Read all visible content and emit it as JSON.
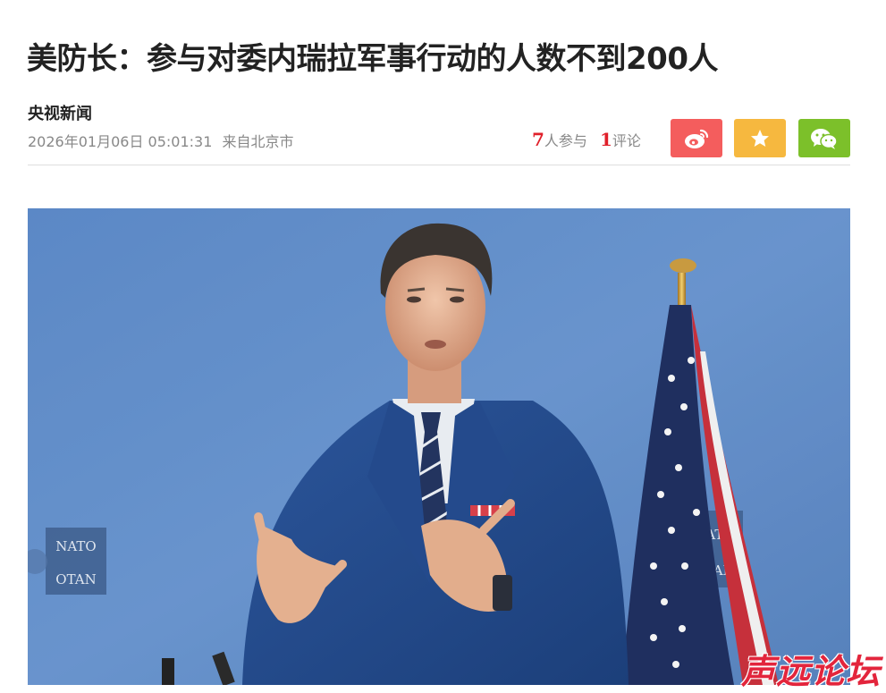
{
  "article": {
    "title": "美防长：参与对委内瑞拉军事行动的人数不到200人",
    "source": "央视新闻",
    "timestamp": "2026年01月06日 05:01:31",
    "location": "来自北京市"
  },
  "stats": {
    "participants_count": "7",
    "participants_label": "人参与",
    "comments_count": "1",
    "comments_label": "评论"
  },
  "share": [
    {
      "name": "weibo-icon",
      "color": "#f45d5d"
    },
    {
      "name": "star-icon",
      "color": "#f6b83f"
    },
    {
      "name": "wechat-icon",
      "color": "#7cc02a"
    }
  ],
  "photo": {
    "signs": [
      "NATO",
      "OTAN"
    ]
  },
  "watermark": "声远论坛"
}
